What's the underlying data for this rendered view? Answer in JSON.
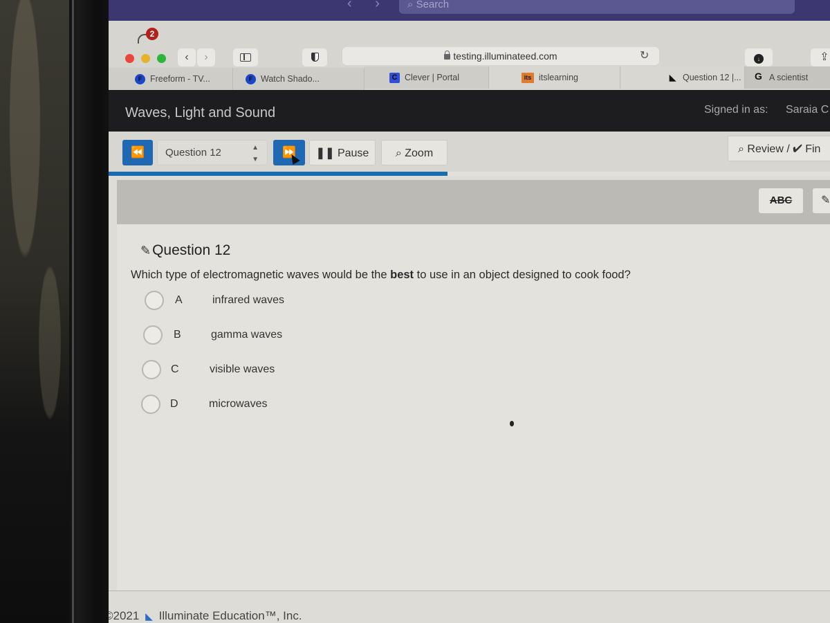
{
  "desktop": {
    "search_placeholder": "Search"
  },
  "browser": {
    "notification_count": "2",
    "url": "testing.illuminateed.com",
    "tabs": [
      {
        "label": "Freeform - TV...",
        "favicon": "F"
      },
      {
        "label": "Watch Shado...",
        "favicon": "F"
      },
      {
        "label": "Clever | Portal",
        "favicon": "C"
      },
      {
        "label": "itslearning",
        "favicon": "its"
      },
      {
        "label": "Question 12 |...",
        "favicon": "illuminate"
      },
      {
        "label": "A scientist",
        "favicon": "G"
      }
    ]
  },
  "app": {
    "title": "Waves, Light and Sound",
    "signed_in_label": "Signed in as:",
    "user_name": "Saraia C"
  },
  "toolbar": {
    "prev_icon": "⏪",
    "question_select": "Question 12",
    "next_icon": "⏩",
    "pause_label": "Pause",
    "zoom_label": "Zoom",
    "review_label": "Review / ✔ Fin",
    "progress": 0.47
  },
  "tools": {
    "strikethrough_label": "ABC",
    "edit_icon": "✎"
  },
  "question": {
    "title": "Question 12",
    "prompt_before": "Which type of electromagnetic waves would be the ",
    "prompt_bold": "best",
    "prompt_after": " to use in an object designed to cook food?",
    "choices": [
      {
        "letter": "A",
        "text": "infrared waves",
        "selected": false
      },
      {
        "letter": "B",
        "text": "gamma waves",
        "selected": false
      },
      {
        "letter": "C",
        "text": "visible waves",
        "selected": false
      },
      {
        "letter": "D",
        "text": "microwaves",
        "selected": false
      }
    ]
  },
  "footer": {
    "copyright": "©2021",
    "company": "Illuminate Education™, Inc."
  }
}
